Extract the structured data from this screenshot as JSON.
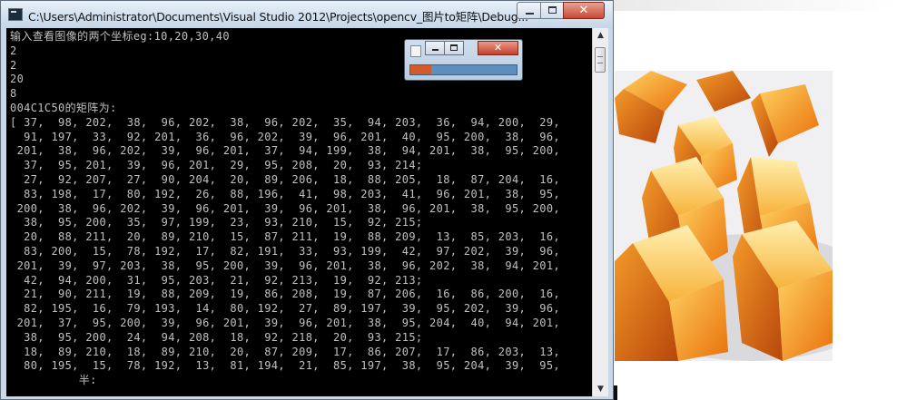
{
  "window": {
    "title": "C:\\Users\\Administrator\\Documents\\Visual Studio 2012\\Projects\\opencv_图片to矩阵\\Debug...",
    "minimize_icon": "minimize-icon",
    "maximize_icon": "maximize-icon",
    "close_icon": "close-icon",
    "close_glyph": "✕"
  },
  "console": {
    "lines": [
      "输入查看图像的两个坐标eg:10,20,30,40",
      "2",
      "2",
      "20",
      "8",
      "004C1C50的矩阵为:",
      "[ 37,  98, 202,  38,  96, 202,  38,  96, 202,  35,  94, 203,  36,  94, 200,  29,",
      "  91, 197,  33,  92, 201,  36,  96, 202,  39,  96, 201,  40,  95, 200,  38,  96,",
      " 201,  38,  96, 202,  39,  96, 201,  37,  94, 199,  38,  94, 201,  38,  95, 200,",
      "  37,  95, 201,  39,  96, 201,  29,  95, 208,  20,  93, 214;",
      "  27,  92, 207,  27,  90, 204,  20,  89, 206,  18,  88, 205,  18,  87, 204,  16,",
      "  83, 198,  17,  80, 192,  26,  88, 196,  41,  98, 203,  41,  96, 201,  38,  95,",
      " 200,  38,  96, 202,  39,  96, 201,  39,  96, 201,  38,  96, 201,  38,  95, 200,",
      "  38,  95, 200,  35,  97, 199,  23,  93, 210,  15,  92, 215;",
      "  20,  88, 211,  20,  89, 210,  15,  87, 211,  19,  88, 209,  13,  85, 203,  16,",
      "  83, 200,  15,  78, 192,  17,  82, 191,  33,  93, 199,  42,  97, 202,  39,  96,",
      " 201,  39,  97, 203,  38,  95, 200,  39,  96, 201,  38,  96, 202,  38,  94, 201,",
      "  42,  94, 200,  31,  95, 203,  21,  92, 213,  19,  92, 213;",
      "  21,  90, 211,  19,  88, 209,  19,  86, 208,  19,  87, 206,  16,  86, 200,  16,",
      "  82, 195,  16,  79, 193,  14,  80, 192,  27,  89, 197,  39,  95, 202,  39,  96,",
      " 201,  37,  95, 200,  39,  96, 201,  39,  96, 201,  38,  95, 204,  40,  94, 201,",
      "  38,  95, 200,  24,  94, 208,  18,  92, 218,  20,  93, 215;",
      "  18,  89, 210,  18,  89, 210,  20,  87, 209,  17,  86, 207,  17,  86, 203,  13,",
      "  80, 195,  15,  78, 192,  13,  81, 194,  21,  85, 197,  38,  95, 204,  39,  95,",
      "          半:"
    ]
  },
  "scrollbar": {
    "up_icon": "scroll-up-arrow-icon",
    "down_icon": "scroll-down-arrow-icon",
    "up_glyph": "▲",
    "down_glyph": "▼"
  },
  "mini_window": {
    "close_glyph": "✕",
    "progress": 0.2
  },
  "colors": {
    "console_bg": "#000000",
    "console_text": "#c0c0c0",
    "progress_fill": "#d45a2a",
    "progress_track": "#5c8fbd",
    "close_button": "#c74a35"
  }
}
